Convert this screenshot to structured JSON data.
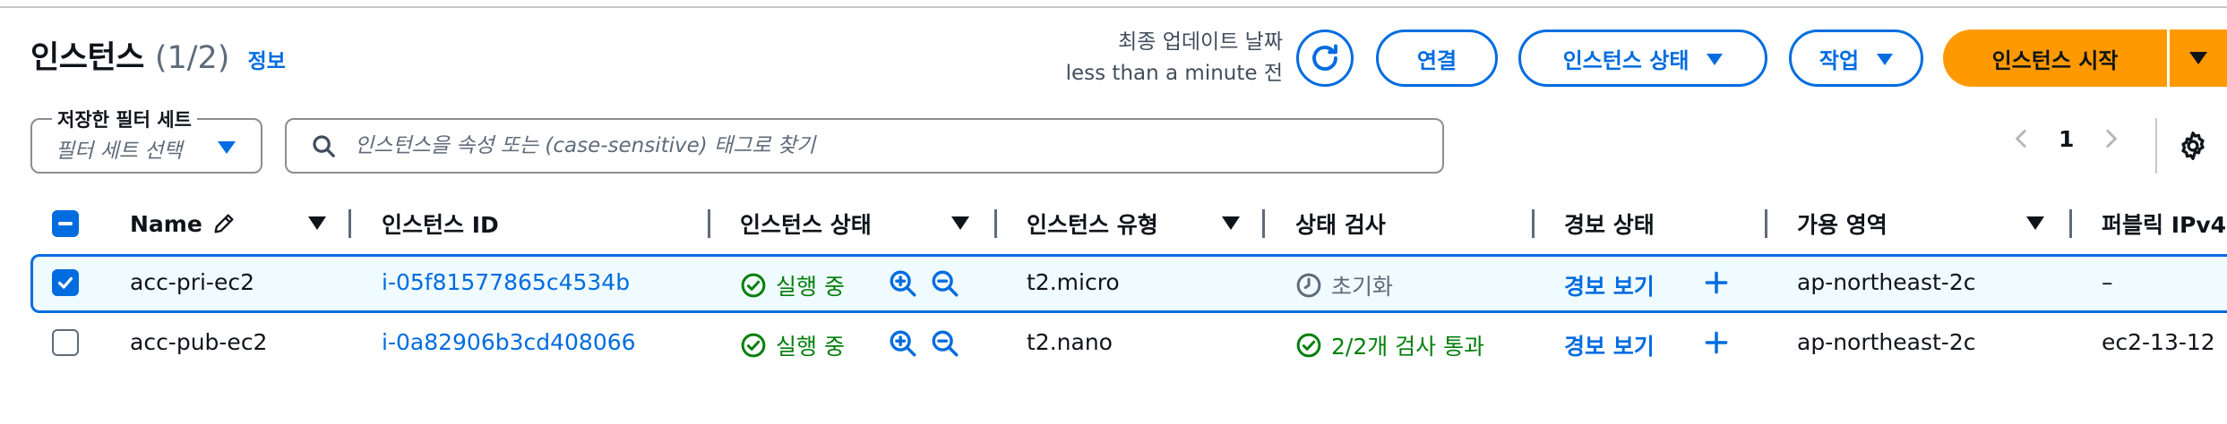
{
  "header": {
    "title": "인스턴스",
    "count": "(1/2)",
    "info_link": "정보",
    "updated_label": "최종 업데이트 날짜",
    "updated_value": "less than a minute 전"
  },
  "toolbar": {
    "connect_label": "연결",
    "instance_state_label": "인스턴스 상태",
    "actions_label": "작업",
    "launch_label": "인스턴스 시작"
  },
  "filters": {
    "saved_set_label": "저장한 필터 세트",
    "saved_set_placeholder": "필터 세트 선택",
    "search_placeholder": "인스턴스을 속성 또는 (case-sensitive) 태그로 찾기"
  },
  "pagination": {
    "current_page": "1"
  },
  "table": {
    "columns": {
      "name": "Name",
      "instance_id": "인스턴스 ID",
      "instance_state": "인스턴스 상태",
      "instance_type": "인스턴스 유형",
      "status_check": "상태 검사",
      "alarm_status": "경보 상태",
      "availability_zone": "가용 영역",
      "public_ipv4": "퍼블릭 IPv4"
    },
    "rows": [
      {
        "name": "acc-pri-ec2",
        "instance_id": "i-05f81577865c4534b",
        "state": "실행 중",
        "type": "t2.micro",
        "status_check": "초기화",
        "alarm_link": "경보 보기",
        "az": "ap-northeast-2c",
        "public_ipv4": "–",
        "selected": true
      },
      {
        "name": "acc-pub-ec2",
        "instance_id": "i-0a82906b3cd408066",
        "state": "실행 중",
        "type": "t2.nano",
        "status_check": "2/2개 검사 통과",
        "alarm_link": "경보 보기",
        "az": "ap-northeast-2c",
        "public_ipv4": "ec2-13-12",
        "selected": false
      }
    ]
  },
  "colors": {
    "accent": "#006ce0",
    "primary_button": "#ff9900",
    "success": "#037f0c",
    "text": "#0f141a"
  },
  "icons": [
    "refresh-icon",
    "caret-down-icon",
    "search-icon",
    "chevron-left-icon",
    "chevron-right-icon",
    "gear-icon",
    "pencil-icon",
    "check-circle-icon",
    "zoom-in-icon",
    "zoom-out-icon",
    "clock-icon",
    "plus-icon"
  ]
}
